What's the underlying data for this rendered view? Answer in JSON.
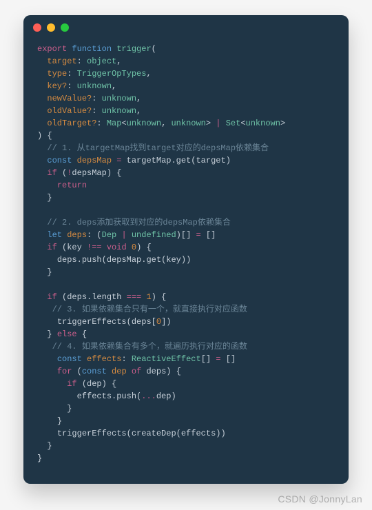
{
  "traffic_lights": [
    "red",
    "yellow",
    "green"
  ],
  "code": {
    "l1": {
      "export": "export",
      "function": "function",
      "name": "trigger",
      "open": "("
    },
    "l2": {
      "param": "target",
      "type": "object"
    },
    "l3": {
      "param": "type",
      "type": "TriggerOpTypes"
    },
    "l4": {
      "param": "key?",
      "type": "unknown"
    },
    "l5": {
      "param": "newValue?",
      "type": "unknown"
    },
    "l6": {
      "param": "oldValue?",
      "type": "unknown"
    },
    "l7": {
      "param": "oldTarget?",
      "map": "Map",
      "unk": "unknown",
      "set": "Set"
    },
    "l8": {
      "close": ") {"
    },
    "l9": {
      "comment": "// 1. 从targetMap找到target对应的depsMap依赖集合"
    },
    "l10": {
      "const": "const",
      "name": "depsMap",
      "expr_a": "targetMap",
      "expr_b": ".get(",
      "expr_c": "target",
      "expr_d": ")"
    },
    "l11": {
      "if": "if",
      "neg": "!",
      "a": "depsMap",
      "b": ") {"
    },
    "l12": {
      "return": "return"
    },
    "l13": {
      "brace": "}"
    },
    "l14_blank": "",
    "l15": {
      "comment": "// 2. deps添加获取到对应的depsMap依赖集合"
    },
    "l16": {
      "let": "let",
      "name": "deps",
      "dep": "Dep",
      "undef": "undefined",
      "arr": "[]"
    },
    "l17": {
      "if": "if",
      "key": "key",
      "ne": "!==",
      "void": "void",
      "zero": "0"
    },
    "l18": {
      "a": "deps",
      "b": ".push(",
      "c": "depsMap",
      "d": ".get(",
      "e": "key",
      "f": "))"
    },
    "l19": {
      "brace": "}"
    },
    "l20_blank": "",
    "l21": {
      "if": "if",
      "deps": "deps",
      "len": ".length",
      "eq": "===",
      "one": "1"
    },
    "l22": {
      "comment": "// 3. 如果依赖集合只有一个，就直接执行对应函数"
    },
    "l23": {
      "fn": "triggerEffects",
      "a": "(",
      "b": "deps",
      "c": "[",
      "zero": "0",
      "d": "])"
    },
    "l24": {
      "else": "} else {",
      "else_kw": "else"
    },
    "l25": {
      "comment": "// 4. 如果依赖集合有多个，就遍历执行对应的函数"
    },
    "l26": {
      "const": "const",
      "name": "effects",
      "type": "ReactiveEffect",
      "arr": "[]"
    },
    "l27": {
      "for": "for",
      "const": "const",
      "dep": "dep",
      "of": "of",
      "deps": "deps"
    },
    "l28": {
      "if": "if",
      "dep": "dep"
    },
    "l29": {
      "a": "effects",
      "b": ".push(",
      "spread": "...",
      "c": "dep",
      "d": ")"
    },
    "l30": {
      "brace": "}"
    },
    "l31": {
      "brace": "}"
    },
    "l32": {
      "fn": "triggerEffects",
      "a": "(",
      "cd": "createDep",
      "b": "(",
      "eff": "effects",
      "c": "))"
    },
    "l33": {
      "brace": "}"
    },
    "l34": {
      "brace": "}"
    }
  },
  "watermark": "CSDN @JonnyLan"
}
